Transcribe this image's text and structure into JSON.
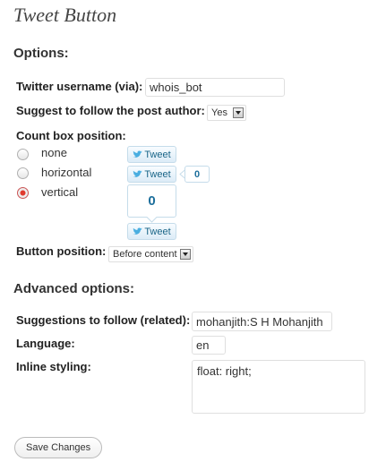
{
  "page": {
    "title": "Tweet Button"
  },
  "options": {
    "title": "Options:",
    "twitter_username": {
      "label": "Twitter username (via):",
      "value": "whois_bot"
    },
    "suggest_follow": {
      "label": "Suggest to follow the post author:",
      "value": "Yes"
    },
    "count_box": {
      "label": "Count box position:",
      "choices": [
        {
          "label": "none",
          "checked": false
        },
        {
          "label": "horizontal",
          "checked": false
        },
        {
          "label": "vertical",
          "checked": true
        }
      ],
      "tweet_label": "Tweet",
      "horizontal_count": "0",
      "vertical_count": "0"
    },
    "button_position": {
      "label": "Button position:",
      "value": "Before content"
    }
  },
  "advanced": {
    "title": "Advanced options:",
    "related": {
      "label": "Suggestions to follow (related):",
      "value": "mohanjith:S H Mohanjith"
    },
    "language": {
      "label": "Language:",
      "value": "en"
    },
    "inline_styling": {
      "label": "Inline styling:",
      "value": "float: right;"
    }
  },
  "actions": {
    "save_label": "Save Changes"
  },
  "colors": {
    "accent_blue": "#1d6f9c",
    "radio_checked": "#e03a2e"
  }
}
